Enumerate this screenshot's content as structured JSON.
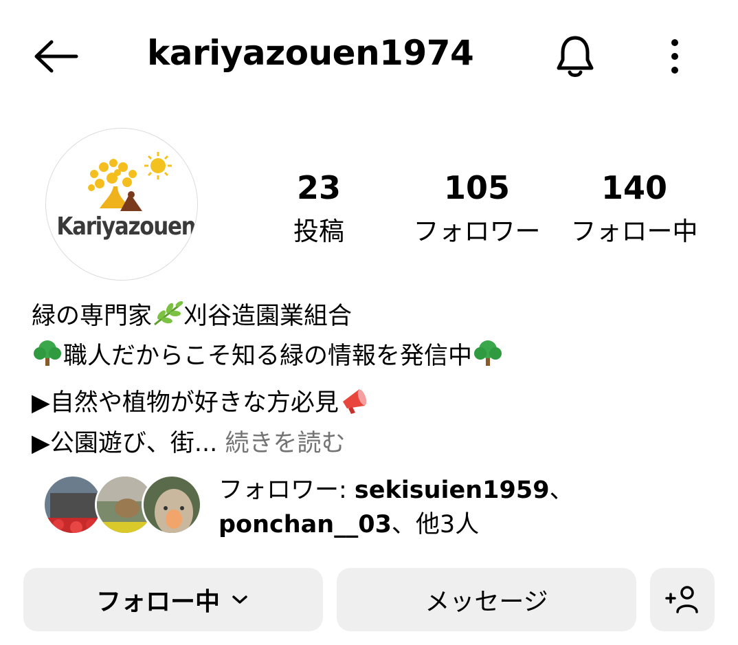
{
  "header": {
    "username": "kariyazouen1974",
    "back_icon": "arrow-left-icon",
    "bell_icon": "bell-icon",
    "more_icon": "more-vertical-icon"
  },
  "profile": {
    "avatar_text": "Kariyazouen",
    "stats": [
      {
        "value": "23",
        "label": "投稿"
      },
      {
        "value": "105",
        "label": "フォロワー"
      },
      {
        "value": "140",
        "label": "フォロー中"
      }
    ]
  },
  "bio": {
    "line1": "緑の専門家",
    "line1b": "刈谷造園業組合",
    "line2": "職人だからこそ知る緑の情報を発信中",
    "line3": "▶自然や植物が好きな方必見",
    "line4": "▶公園遊び、街...",
    "more": "続きを読む"
  },
  "followed_by": {
    "prefix": "フォロワー: ",
    "user1": "sekisuien1959",
    "sep": "、",
    "user2": "ponchan__03",
    "suffix": "、他3人"
  },
  "actions": {
    "following_label": "フォロー中",
    "message_label": "メッセージ",
    "add_icon": "person-add-icon"
  },
  "colors": {
    "button_bg": "#efefef",
    "muted_text": "#737373",
    "logo_yellow": "#f0b21c",
    "logo_brown": "#7a3b1c"
  }
}
